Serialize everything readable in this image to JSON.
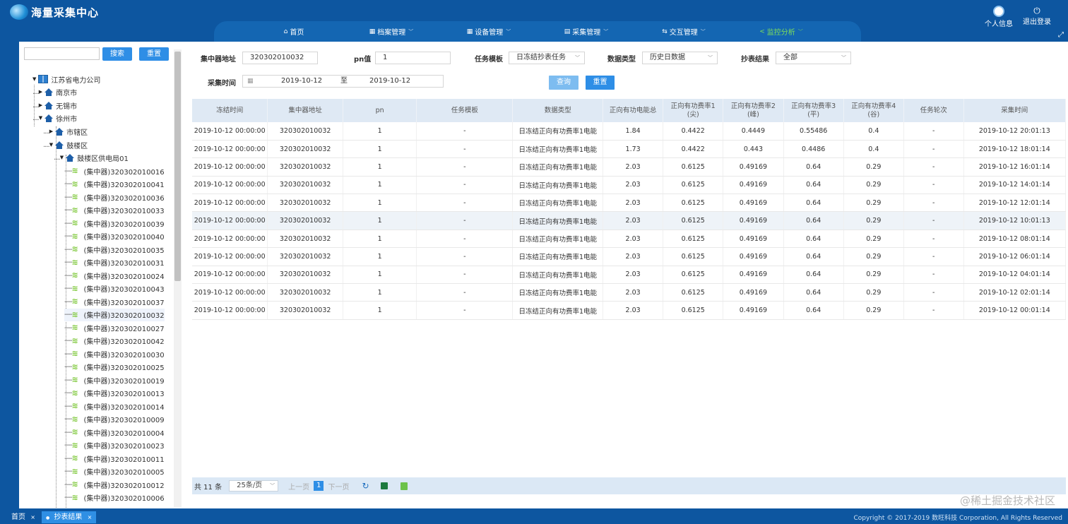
{
  "header": {
    "app_title": "海量采集中心",
    "user_info_label": "个人信息",
    "logout_label": "退出登录",
    "nav": [
      {
        "label": "首页",
        "icon": "home-icon"
      },
      {
        "label": "档案管理",
        "icon": "grid-icon"
      },
      {
        "label": "设备管理",
        "icon": "grid-icon"
      },
      {
        "label": "采集管理",
        "icon": "list-icon"
      },
      {
        "label": "交互管理",
        "icon": "swap-icon"
      },
      {
        "label": "监控分析",
        "icon": "share-icon",
        "active": true
      }
    ]
  },
  "sidebar": {
    "search_placeholder": "",
    "search_button": "搜索",
    "reset_button": "重置",
    "tree": {
      "root": "江苏省电力公司",
      "cities": [
        "南京市",
        "无锡市",
        "徐州市"
      ],
      "districts": [
        "市辖区",
        "鼓楼区"
      ],
      "bureau": "鼓楼区供电局01",
      "nodes": [
        "(集中器)320302010016",
        "(集中器)320302010041",
        "(集中器)320302010036",
        "(集中器)320302010033",
        "(集中器)320302010039",
        "(集中器)320302010040",
        "(集中器)320302010035",
        "(集中器)320302010031",
        "(集中器)320302010024",
        "(集中器)320302010043",
        "(集中器)320302010037",
        "(集中器)320302010032",
        "(集中器)320302010027",
        "(集中器)320302010042",
        "(集中器)320302010030",
        "(集中器)320302010025",
        "(集中器)320302010019",
        "(集中器)320302010013",
        "(集中器)320302010014",
        "(集中器)320302010009",
        "(集中器)320302010004",
        "(集中器)320302010023",
        "(集中器)320302010011",
        "(集中器)320302010005",
        "(集中器)320302010012",
        "(集中器)320302010006"
      ]
    }
  },
  "filters": {
    "concentrator_label": "集中器地址",
    "concentrator_value": "320302010032",
    "pn_label": "pn值",
    "pn_value": "1",
    "template_label": "任务模板",
    "template_value": "日冻结抄表任务",
    "datatype_label": "数据类型",
    "datatype_value": "历史日数据",
    "result_label": "抄表结果",
    "result_value": "全部",
    "time_label": "采集时间",
    "time_from": "2019-10-12",
    "time_sep": "至",
    "time_to": "2019-10-12",
    "query_button": "查询",
    "reset_button": "重置"
  },
  "table": {
    "columns": [
      "冻结时间",
      "集中器地址",
      "pn",
      "任务模板",
      "数据类型",
      "正向有功电能总",
      "正向有功费率1\n(尖)",
      "正向有功费率2\n(峰)",
      "正向有功费率3\n(平)",
      "正向有功费率4\n(谷)",
      "任务轮次",
      "采集时间"
    ],
    "rows": [
      [
        "2019-10-12 00:00:00",
        "320302010032",
        "1",
        "-",
        "日冻结正向有功费率1电能",
        "1.84",
        "0.4422",
        "0.4449",
        "0.55486",
        "0.4",
        "-",
        "2019-10-12 20:01:13"
      ],
      [
        "2019-10-12 00:00:00",
        "320302010032",
        "1",
        "-",
        "日冻结正向有功费率1电能",
        "1.73",
        "0.4422",
        "0.443",
        "0.4486",
        "0.4",
        "-",
        "2019-10-12 18:01:14"
      ],
      [
        "2019-10-12 00:00:00",
        "320302010032",
        "1",
        "-",
        "日冻结正向有功费率1电能",
        "2.03",
        "0.6125",
        "0.49169",
        "0.64",
        "0.29",
        "-",
        "2019-10-12 16:01:14"
      ],
      [
        "2019-10-12 00:00:00",
        "320302010032",
        "1",
        "-",
        "日冻结正向有功费率1电能",
        "2.03",
        "0.6125",
        "0.49169",
        "0.64",
        "0.29",
        "-",
        "2019-10-12 14:01:14"
      ],
      [
        "2019-10-12 00:00:00",
        "320302010032",
        "1",
        "-",
        "日冻结正向有功费率1电能",
        "2.03",
        "0.6125",
        "0.49169",
        "0.64",
        "0.29",
        "-",
        "2019-10-12 12:01:14"
      ],
      [
        "2019-10-12 00:00:00",
        "320302010032",
        "1",
        "-",
        "日冻结正向有功费率1电能",
        "2.03",
        "0.6125",
        "0.49169",
        "0.64",
        "0.29",
        "-",
        "2019-10-12 10:01:13"
      ],
      [
        "2019-10-12 00:00:00",
        "320302010032",
        "1",
        "-",
        "日冻结正向有功费率1电能",
        "2.03",
        "0.6125",
        "0.49169",
        "0.64",
        "0.29",
        "-",
        "2019-10-12 08:01:14"
      ],
      [
        "2019-10-12 00:00:00",
        "320302010032",
        "1",
        "-",
        "日冻结正向有功费率1电能",
        "2.03",
        "0.6125",
        "0.49169",
        "0.64",
        "0.29",
        "-",
        "2019-10-12 06:01:14"
      ],
      [
        "2019-10-12 00:00:00",
        "320302010032",
        "1",
        "-",
        "日冻结正向有功费率1电能",
        "2.03",
        "0.6125",
        "0.49169",
        "0.64",
        "0.29",
        "-",
        "2019-10-12 04:01:14"
      ],
      [
        "2019-10-12 00:00:00",
        "320302010032",
        "1",
        "-",
        "日冻结正向有功费率1电能",
        "2.03",
        "0.6125",
        "0.49169",
        "0.64",
        "0.29",
        "-",
        "2019-10-12 02:01:14"
      ],
      [
        "2019-10-12 00:00:00",
        "320302010032",
        "1",
        "-",
        "日冻结正向有功费率1电能",
        "2.03",
        "0.6125",
        "0.49169",
        "0.64",
        "0.29",
        "-",
        "2019-10-12 00:01:14"
      ]
    ],
    "highlighted_row": 5
  },
  "pager": {
    "total": "共 11 条",
    "page_size": "25条/页",
    "prev": "上一页",
    "current": "1",
    "next": "下一页"
  },
  "bottom": {
    "tabs": [
      {
        "label": "首页"
      },
      {
        "label": "抄表结果",
        "active": true
      }
    ],
    "copyright": "Copyright © 2017-2019 数旺科技 Corporation, All Rights Reserved",
    "watermark": "@稀土掘金技术社区"
  },
  "colors": {
    "brand": "#0d56a0",
    "accent": "#2e8ee6",
    "active_nav": "#7fe05a"
  }
}
